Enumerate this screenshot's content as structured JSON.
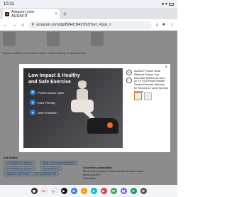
{
  "status": {
    "time": "10:31"
  },
  "tab": {
    "title": "Amazon.com : AUDAFIT"
  },
  "omnibox": {
    "url": "amazon.com/dp/B0HCB4V3S5?ref_=ppx_t"
  },
  "page": {
    "breadcrumb": "Sports & Outdoors › Exercise & Fitness › Cardio Training › Pedal Exercisers",
    "ask_label": "Ask Rufus",
    "chips": [
      "Is it suitable for elderly?",
      "What is the maximum speed?",
      "Is it suitable for seniors?",
      "How quiet is it?",
      "Compare with similar",
      "Ask something else"
    ],
    "side_info": {
      "heading": "Currently unavailable.",
      "sub": "We don't know when or if this item will be back in stock.",
      "brand_label": "Brand",
      "brand_value": "AUDAFIT",
      "color_label": "Color",
      "color_value": "Black"
    }
  },
  "modal": {
    "hero_title": "Low Impact & Healthy and Safe Exercise",
    "bullets": [
      "Protect lumbar Spine",
      "Knee Friendly",
      "Joint Protection"
    ],
    "description": "AUDAFIT Under Desk Elliptical Eclipse Leg Exerciser Electric as seen on TV Foot Pedal Peddler Seated Exercise Machine for Seniors 12 Level Speeds Manual..."
  }
}
